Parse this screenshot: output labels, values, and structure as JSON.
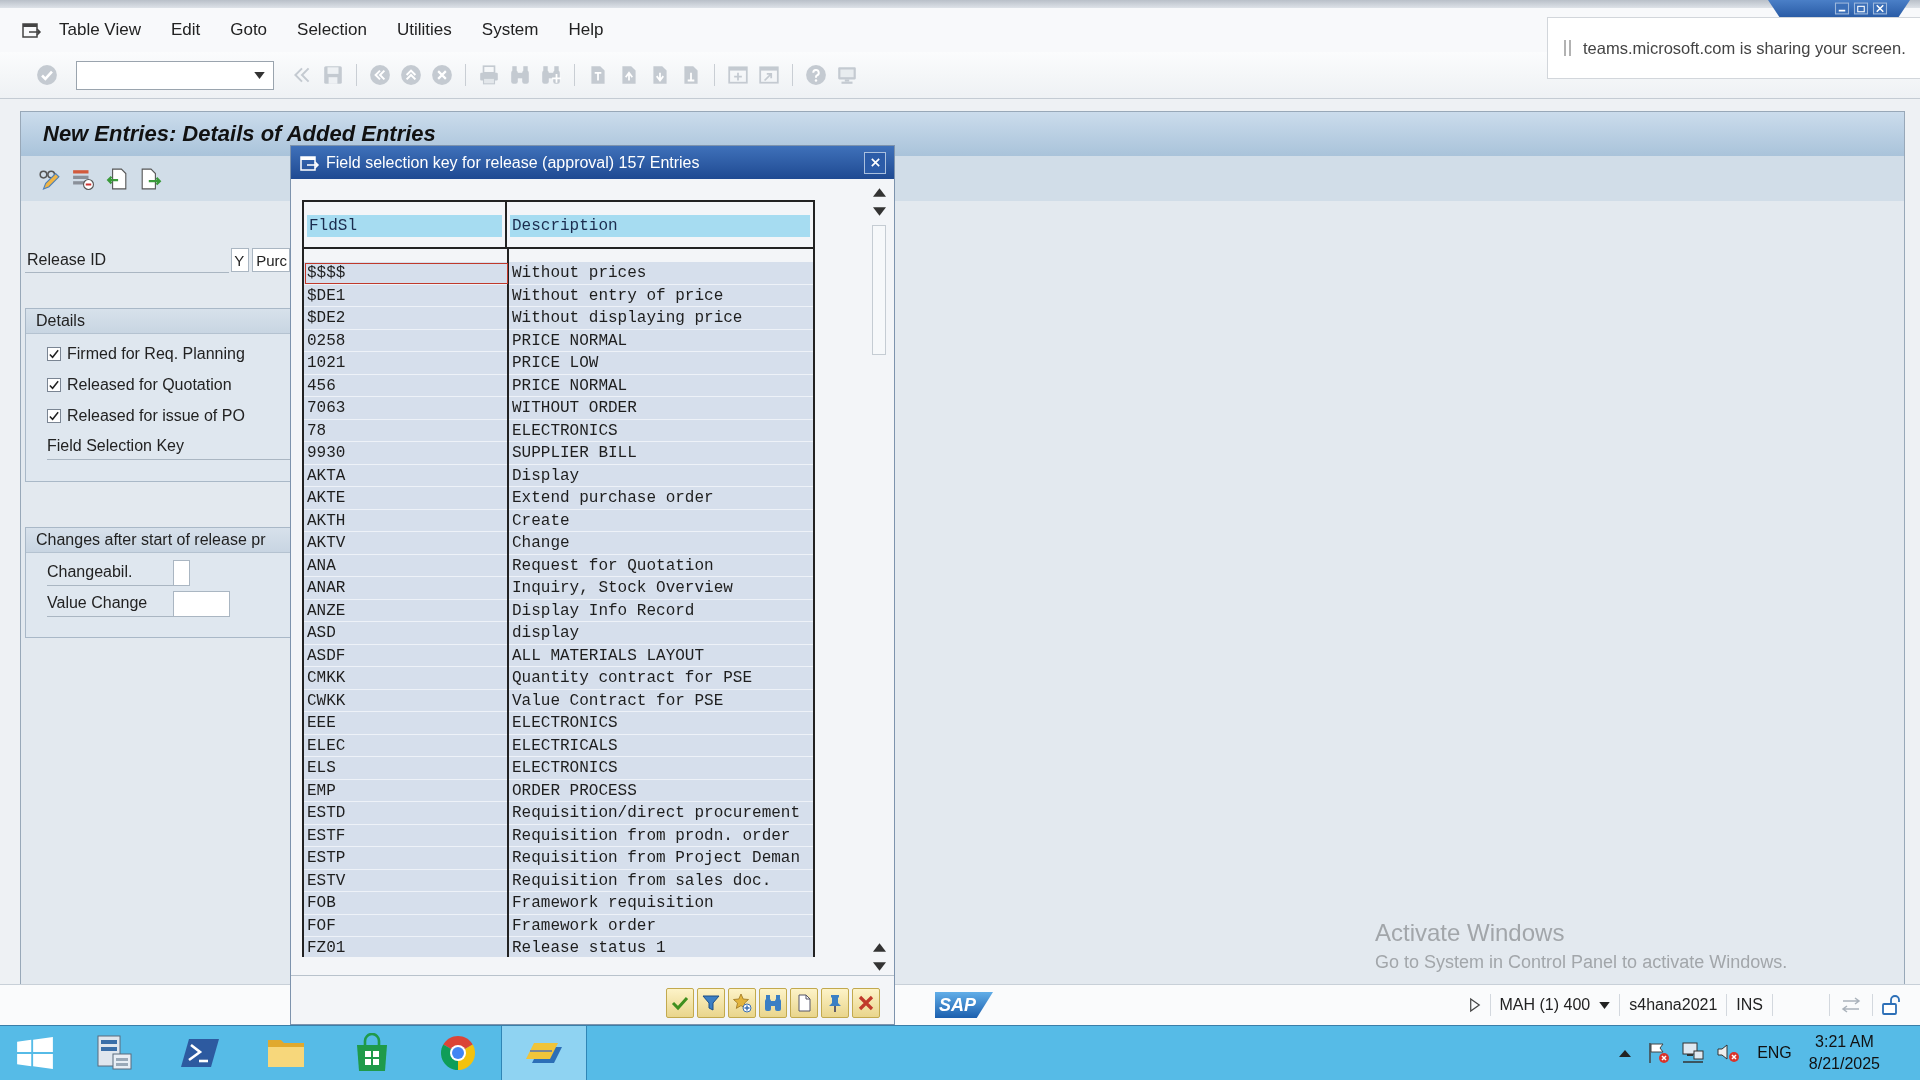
{
  "menu_bar": {
    "items": [
      "Table View",
      "Edit",
      "Goto",
      "Selection",
      "Utilities",
      "System",
      "Help"
    ]
  },
  "screen_share_notice": {
    "text": "teams.microsoft.com is sharing your screen."
  },
  "screen": {
    "title": "New Entries: Details of Added Entries",
    "release_id": {
      "label": "Release ID",
      "code": "Y",
      "description": "Purc"
    },
    "details": {
      "title": "Details",
      "items": [
        {
          "kind": "checkbox",
          "label": "Firmed for Req. Planning",
          "checked": true
        },
        {
          "kind": "checkbox",
          "label": "Released for Quotation",
          "checked": true
        },
        {
          "kind": "checkbox",
          "label": "Released for issue of PO",
          "checked": true
        },
        {
          "kind": "field",
          "label": "Field Selection Key"
        }
      ]
    },
    "changes": {
      "title": "Changes after start of release pr",
      "fields": [
        {
          "kind": "short",
          "label": "Changeabil."
        },
        {
          "kind": "long",
          "label": "Value Change"
        }
      ]
    }
  },
  "dialog": {
    "title": "Field selection key for release (approval) 157 Entries",
    "columns": [
      "FldSl",
      "Description"
    ],
    "rows": [
      {
        "key": "$$$$",
        "description": "Without prices",
        "selected": true
      },
      {
        "key": "$DE1",
        "description": "Without entry of price",
        "selected": false
      },
      {
        "key": "$DE2",
        "description": "Without displaying price",
        "selected": false
      },
      {
        "key": "0258",
        "description": "PRICE NORMAL",
        "selected": false
      },
      {
        "key": "1021",
        "description": "PRICE LOW",
        "selected": false
      },
      {
        "key": "456",
        "description": "PRICE NORMAL",
        "selected": false
      },
      {
        "key": "7063",
        "description": "WITHOUT ORDER",
        "selected": false
      },
      {
        "key": "78",
        "description": "ELECTRONICS",
        "selected": false
      },
      {
        "key": "9930",
        "description": "SUPPLIER BILL",
        "selected": false
      },
      {
        "key": "AKTA",
        "description": "Display",
        "selected": false
      },
      {
        "key": "AKTE",
        "description": "Extend purchase order",
        "selected": false
      },
      {
        "key": "AKTH",
        "description": "Create",
        "selected": false
      },
      {
        "key": "AKTV",
        "description": "Change",
        "selected": false
      },
      {
        "key": "ANA",
        "description": "Request for Quotation",
        "selected": false
      },
      {
        "key": "ANAR",
        "description": "Inquiry, Stock Overview",
        "selected": false
      },
      {
        "key": "ANZE",
        "description": "Display Info Record",
        "selected": false
      },
      {
        "key": "ASD",
        "description": "display",
        "selected": false
      },
      {
        "key": "ASDF",
        "description": "ALL MATERIALS LAYOUT",
        "selected": false
      },
      {
        "key": "CMKK",
        "description": "Quantity contract for PSE",
        "selected": false
      },
      {
        "key": "CWKK",
        "description": "Value Contract for PSE",
        "selected": false
      },
      {
        "key": "EEE",
        "description": "ELECTRONICS",
        "selected": false
      },
      {
        "key": "ELEC",
        "description": "ELECTRICALS",
        "selected": false
      },
      {
        "key": "ELS",
        "description": "ELECTRONICS",
        "selected": false
      },
      {
        "key": "EMP",
        "description": "ORDER PROCESS",
        "selected": false
      },
      {
        "key": "ESTD",
        "description": "Requisition/direct procurement",
        "selected": false
      },
      {
        "key": "ESTF",
        "description": "Requisition from prodn. order",
        "selected": false
      },
      {
        "key": "ESTP",
        "description": "Requisition from Project Deman",
        "selected": false
      },
      {
        "key": "ESTV",
        "description": "Requisition from sales doc.",
        "selected": false
      },
      {
        "key": "FOB",
        "description": "Framework requisition",
        "selected": false
      },
      {
        "key": "FOF",
        "description": "Framework order",
        "selected": false
      },
      {
        "key": "FZ01",
        "description": "Release status 1",
        "selected": false
      }
    ]
  },
  "status_bar": {
    "logo": "SAP",
    "session": "MAH (1) 400",
    "server": "s4hana2021",
    "mode": "INS"
  },
  "activation_notice": {
    "title": "Activate Windows",
    "text": "Go to System in Control Panel to activate Windows."
  },
  "taskbar": {
    "apps": [
      {
        "kind": "server",
        "selected": false
      },
      {
        "kind": "shell",
        "selected": false
      },
      {
        "kind": "folder",
        "selected": false
      },
      {
        "kind": "store",
        "selected": false
      },
      {
        "kind": "browser",
        "selected": false
      },
      {
        "kind": "sapgui",
        "selected": true
      }
    ],
    "language": "ENG",
    "time": "3:21 AM",
    "date": "8/21/2025"
  }
}
